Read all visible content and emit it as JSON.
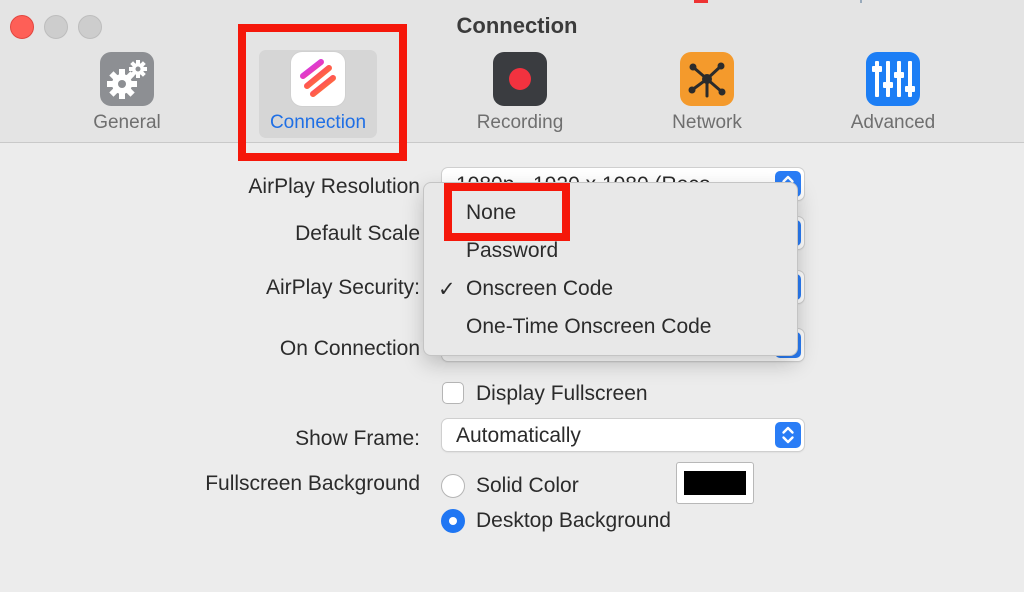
{
  "window": {
    "title": "Connection"
  },
  "toolbar": {
    "tabs": [
      {
        "label": "General",
        "icon": "gears-icon"
      },
      {
        "label": "Connection",
        "icon": "connection-app-icon"
      },
      {
        "label": "Recording",
        "icon": "record-icon"
      },
      {
        "label": "Network",
        "icon": "network-icon"
      },
      {
        "label": "Advanced",
        "icon": "sliders-icon"
      }
    ],
    "selected": "Connection"
  },
  "form": {
    "airplay_resolution_label": "AirPlay Resolution",
    "airplay_resolution_value": "1080p - 1920 x 1080 (Reco",
    "default_scale_label": "Default Scale",
    "airplay_security_label": "AirPlay Security:",
    "on_connection_label": "On Connection",
    "display_fullscreen_label": "Display Fullscreen",
    "show_frame_label": "Show Frame:",
    "show_frame_value": "Automatically",
    "fullscreen_background_label": "Fullscreen Background",
    "solid_color_label": "Solid Color",
    "desktop_background_label": "Desktop Background"
  },
  "menu": {
    "items": [
      {
        "label": "None",
        "checked": false
      },
      {
        "label": "Password",
        "checked": false
      },
      {
        "label": "Onscreen Code",
        "checked": true
      },
      {
        "label": "One-Time Onscreen Code",
        "checked": false
      }
    ],
    "check_glyph": "✓"
  },
  "colors": {
    "accent": "#1f76f3",
    "highlight": "#f5170a",
    "solid_color_swatch": "#000000"
  }
}
